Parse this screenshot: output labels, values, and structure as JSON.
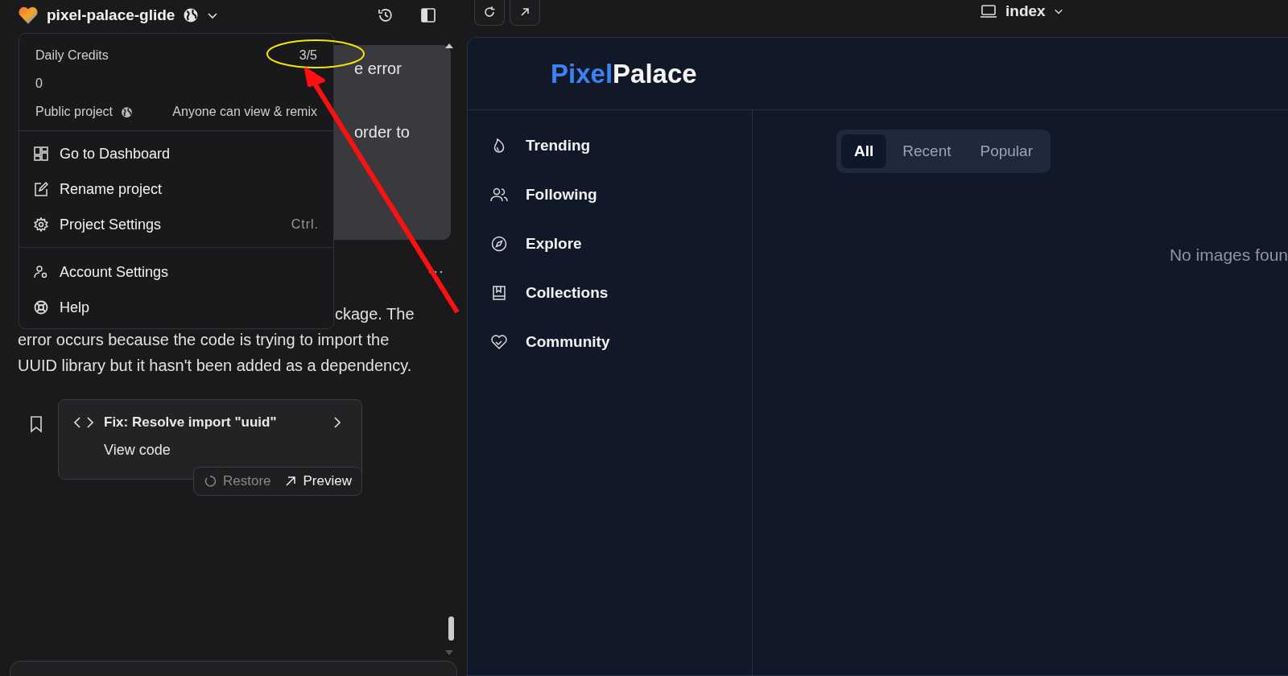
{
  "topbar": {
    "project_name": "pixel-palace-glide",
    "preview_route": "index"
  },
  "chat": {
    "bubble_fragments": [
      "e error",
      "order to"
    ],
    "paragraph_fragment": "ckage. The",
    "paragraph": "error occurs because the code is trying to import the UUID library but it hasn't been added as a dependency.",
    "fix_card": {
      "title": "Fix: Resolve import \"uuid\"",
      "link": "View code"
    },
    "actions": [
      {
        "label": "Restore",
        "disabled": true
      },
      {
        "label": "Preview",
        "disabled": false
      }
    ]
  },
  "menu": {
    "credits_label": "Daily Credits",
    "credits_value": "3/5",
    "credits_remaining": "0",
    "visibility_label": "Public project",
    "visibility_note": "Anyone can view & remix",
    "sections": [
      [
        {
          "label": "Go to Dashboard"
        },
        {
          "label": "Rename project"
        },
        {
          "label": "Project Settings",
          "shortcut": "Ctrl."
        }
      ],
      [
        {
          "label": "Account Settings"
        },
        {
          "label": "Help"
        }
      ]
    ]
  },
  "preview": {
    "logo": {
      "first": "Pixel",
      "second": "Palace"
    },
    "nav": [
      {
        "label": "Trending"
      },
      {
        "label": "Following"
      },
      {
        "label": "Explore"
      },
      {
        "label": "Collections"
      },
      {
        "label": "Community"
      }
    ],
    "tabs": [
      {
        "label": "All",
        "selected": true
      },
      {
        "label": "Recent",
        "selected": false
      },
      {
        "label": "Popular",
        "selected": false
      }
    ],
    "empty_message": "No images foun"
  }
}
